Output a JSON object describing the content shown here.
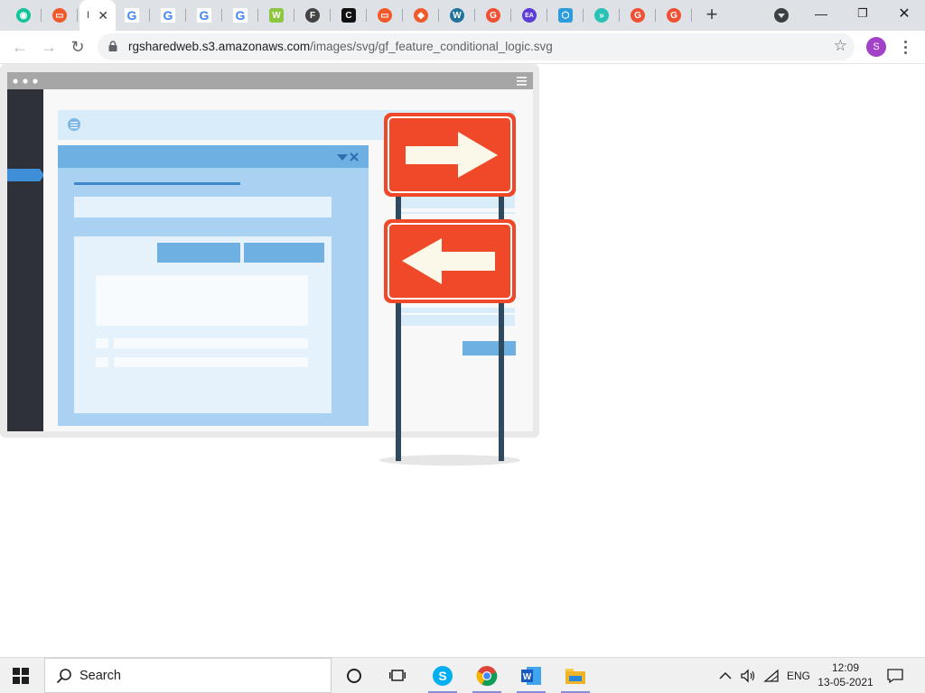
{
  "tabs": [
    {
      "name": "grammarly-tab",
      "icon": "grammarly-icon",
      "color": "#15c39a",
      "glyph": "◉"
    },
    {
      "name": "pdf-tab",
      "icon": "orange-doc-icon",
      "color": "#f1592a",
      "glyph": "▭"
    },
    {
      "name": "active-tab",
      "title": "I",
      "active": true
    },
    {
      "name": "google-tab-1",
      "icon": "google-icon",
      "glyph": "G"
    },
    {
      "name": "google-tab-2",
      "icon": "google-icon",
      "glyph": "G"
    },
    {
      "name": "google-tab-3",
      "icon": "google-icon",
      "glyph": "G"
    },
    {
      "name": "google-tab-4",
      "icon": "google-icon",
      "glyph": "G"
    },
    {
      "name": "w-tab",
      "icon": "w-icon",
      "color": "#8dc63f",
      "glyph": "W"
    },
    {
      "name": "circle-f-tab",
      "icon": "circle-f-icon",
      "color": "#444444",
      "glyph": "F"
    },
    {
      "name": "c-tab",
      "icon": "c-icon",
      "color": "#111111",
      "glyph": "C"
    },
    {
      "name": "orange-tab-2",
      "icon": "orange-doc-icon",
      "color": "#f1592a",
      "glyph": "▭"
    },
    {
      "name": "orange-tab-3",
      "icon": "orange-chat-icon",
      "color": "#f1592a",
      "glyph": "◆"
    },
    {
      "name": "wordpress-tab",
      "icon": "wordpress-icon",
      "color": "#21759b",
      "glyph": "W"
    },
    {
      "name": "g-red-tab-1",
      "icon": "red-g-icon",
      "color": "#f05033",
      "glyph": "G"
    },
    {
      "name": "ea-tab",
      "icon": "ea-icon",
      "color": "#5b3cd8",
      "glyph": "EA"
    },
    {
      "name": "hex-tab",
      "icon": "hexagon-icon",
      "color": "#2d9cdb",
      "glyph": "⬡"
    },
    {
      "name": "arrows-tab",
      "icon": "teal-arrows-icon",
      "color": "#27c2b5",
      "glyph": "»"
    },
    {
      "name": "g-red-tab-2",
      "icon": "red-g-icon",
      "color": "#f05033",
      "glyph": "G"
    },
    {
      "name": "g-red-tab-3",
      "icon": "red-g-icon",
      "color": "#f05033",
      "glyph": "G"
    }
  ],
  "address": {
    "host": "rgsharedweb.s3.amazonaws.com",
    "path": "/images/svg/gf_feature_conditional_logic.svg"
  },
  "profile_initial": "S",
  "window_controls": {
    "minimize": "—",
    "restore": "❐",
    "close": "✕"
  },
  "taskbar": {
    "search_label": "Search",
    "language": "ENG",
    "time": "12:09",
    "date": "13-05-2021"
  },
  "colors": {
    "sign_red": "#f0492a",
    "sidebar_dark": "#2f3138",
    "panel_blue": "#a8d1f2",
    "accent_blue": "#6fb0e3",
    "pole": "#2f4a5e"
  }
}
